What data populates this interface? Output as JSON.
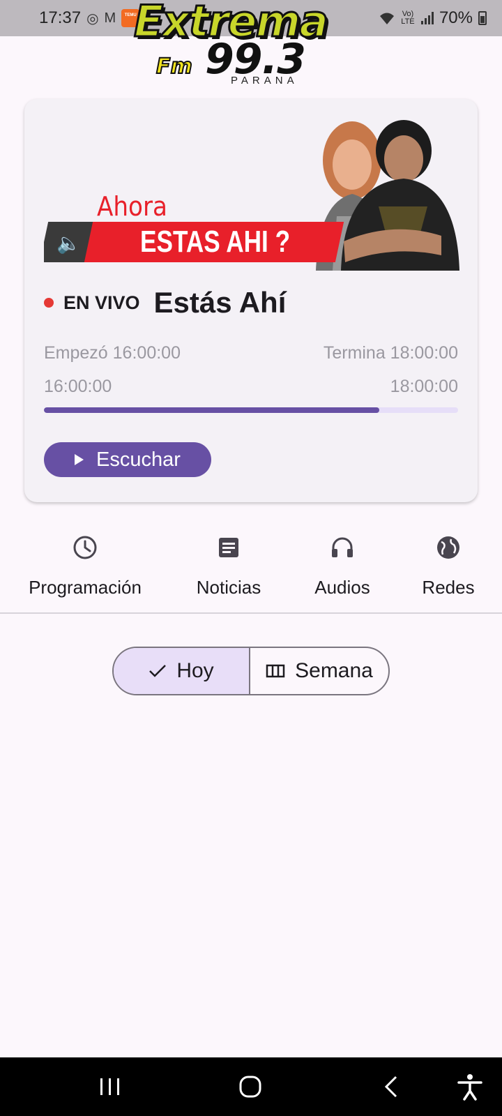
{
  "status_bar": {
    "time": "17:37",
    "temu_badge": "TEMU",
    "volte": "Vo) LTE",
    "battery": "70%",
    "icons": [
      "whatsapp-icon",
      "gmail-icon",
      "temu-icon",
      "wifi-icon",
      "volte-icon",
      "signal-icon",
      "battery-icon"
    ]
  },
  "logo": {
    "name": "Extrema",
    "fm": "Fm",
    "frequency": "99.3",
    "city": "PARANA"
  },
  "now_playing": {
    "banner_prefix": "Ahora",
    "banner_title": "ESTAS AHI ?",
    "live_label": "EN VIVO",
    "show_name": "Estás Ahí",
    "started": "Empezó 16:00:00",
    "ends": "Termina 18:00:00",
    "start_time": "16:00:00",
    "end_time": "18:00:00",
    "progress": 0.81,
    "listen_label": "Escuchar"
  },
  "tabs": [
    {
      "label": "Programación",
      "icon": "clock-icon"
    },
    {
      "label": "Noticias",
      "icon": "article-icon"
    },
    {
      "label": "Audios",
      "icon": "headphones-icon"
    },
    {
      "label": "Redes",
      "icon": "globe-icon"
    }
  ],
  "segments": [
    {
      "label": "Hoy",
      "icon": "check-icon",
      "selected": true
    },
    {
      "label": "Semana",
      "icon": "calendar-view-week-icon",
      "selected": false
    }
  ],
  "colors": {
    "accent": "#6750A4",
    "accent_container": "#E8DEF8",
    "live_dot": "#E53935",
    "banner_red": "#E8202A",
    "logo_green": "#C8D62A"
  }
}
